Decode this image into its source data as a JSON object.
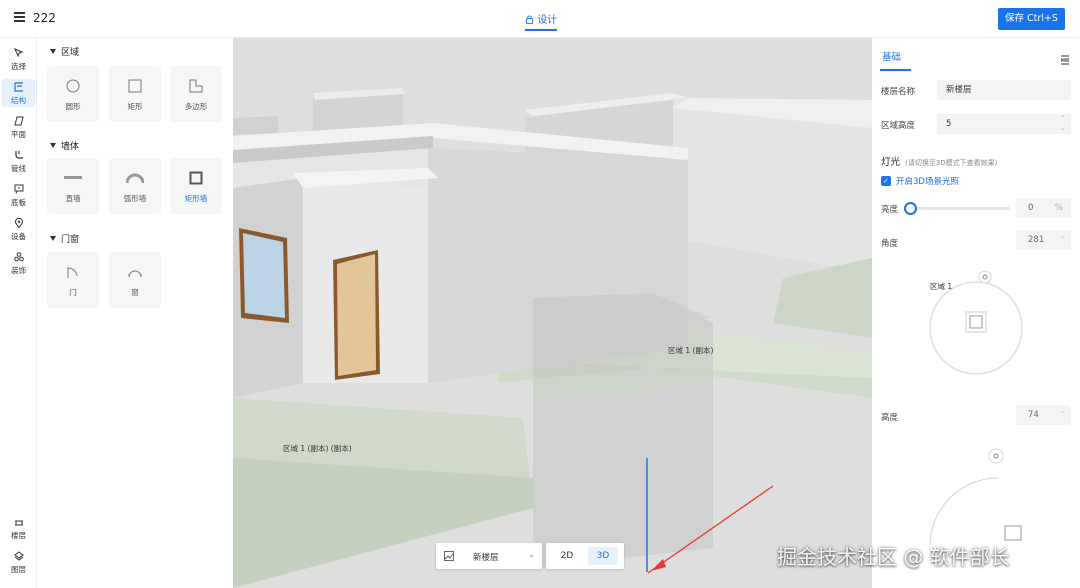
{
  "header": {
    "title": "222",
    "design_tab": "设计",
    "save_label": "保存 Ctrl+S"
  },
  "toolrail": {
    "tools": [
      {
        "label": "选择",
        "icon": "cursor-icon"
      },
      {
        "label": "结构",
        "icon": "structure-icon"
      },
      {
        "label": "平面",
        "icon": "plane-icon"
      },
      {
        "label": "管线",
        "icon": "pipeline-icon"
      },
      {
        "label": "底板",
        "icon": "baseboard-icon"
      },
      {
        "label": "设备",
        "icon": "location-pin-icon"
      },
      {
        "label": "装饰",
        "icon": "decoration-icon"
      }
    ],
    "bottom": [
      {
        "label": "楼层",
        "icon": "floors-icon"
      },
      {
        "label": "图层",
        "icon": "layers-icon"
      }
    ],
    "active_index": 1
  },
  "left_panel": {
    "sections": [
      {
        "title": "区域",
        "items": [
          "圆形",
          "矩形",
          "多边形"
        ]
      },
      {
        "title": "墙体",
        "items": [
          "直墙",
          "弧形墙",
          "矩形墙"
        ]
      },
      {
        "title": "门窗",
        "items": [
          "门",
          "窗"
        ]
      }
    ],
    "active_item": "矩形墙"
  },
  "viewport": {
    "labels": {
      "area_copy": "区域 1 (副本)",
      "area_copy_copy": "区域 1 (副本) (副本)"
    },
    "floor_select": "新楼层",
    "modes": [
      "2D",
      "3D"
    ],
    "active_mode": "3D"
  },
  "right_panel": {
    "tab": "基础",
    "floor_name_label": "楼层名称",
    "floor_name_value": "新楼层",
    "area_height_label": "区域高度",
    "area_height_value": "5",
    "light_title": "灯光",
    "light_hint": "(请切换至3D模式下查看效果)",
    "light_enable_label": "开启3D场景光照",
    "brightness_label": "亮度",
    "brightness_value": "0",
    "brightness_unit": "%",
    "angle_label": "角度",
    "angle_value": "281",
    "angle_area_label": "区域 1",
    "height_label": "高度",
    "height_value": "74"
  },
  "watermark": "掘金技术社区 @ 软件部长",
  "colors": {
    "accent": "#1a73e8"
  }
}
